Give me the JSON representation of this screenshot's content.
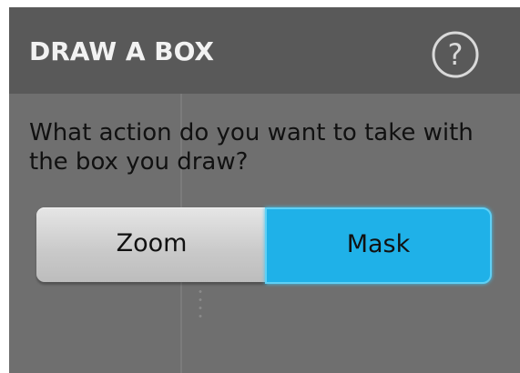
{
  "dialog": {
    "title": "DRAW A BOX",
    "help_icon": "help-circle-icon",
    "prompt": "What action do you want to take with the box you draw?",
    "options": [
      {
        "label": "Zoom",
        "selected": false
      },
      {
        "label": "Mask",
        "selected": true
      }
    ]
  },
  "colors": {
    "header_bg": "#595959",
    "body_bg": "#6f6f6f",
    "selected_accent": "#1fb1e8",
    "unselected_button": "#d0d0d0"
  }
}
